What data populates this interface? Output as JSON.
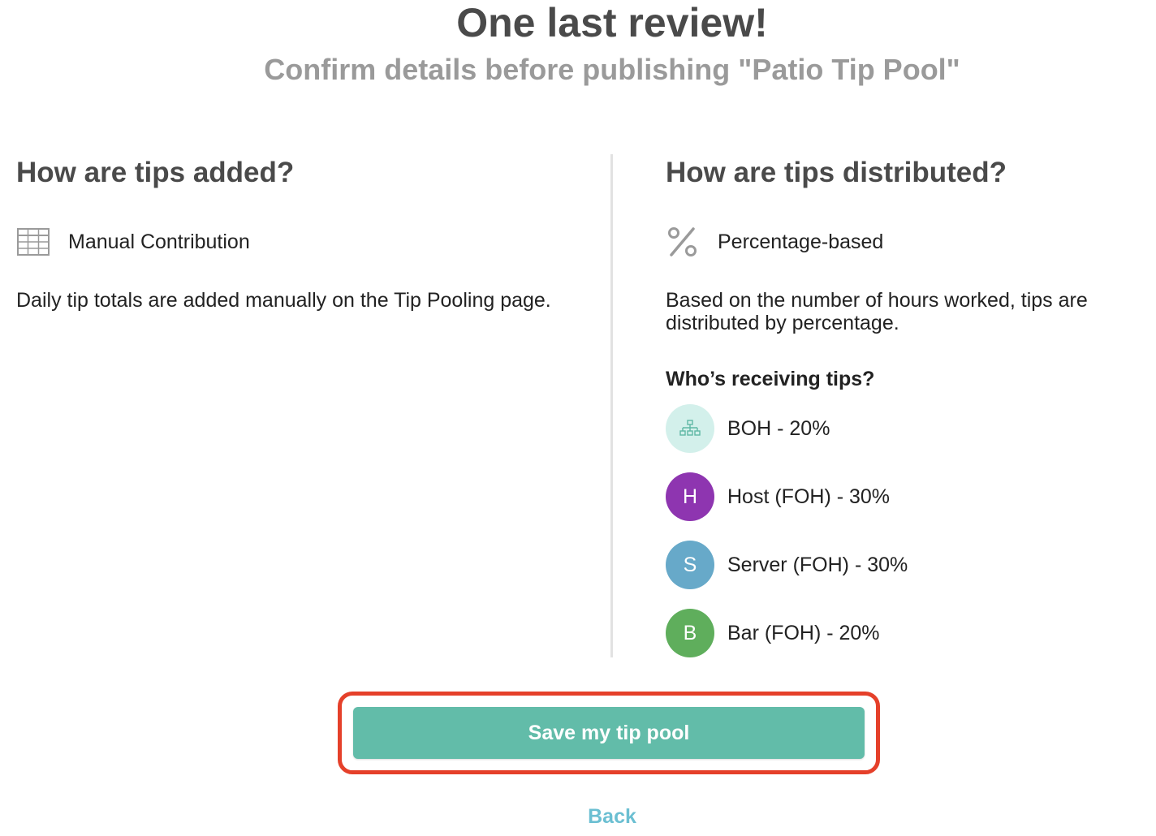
{
  "header": {
    "title": "One last review!",
    "subtitle": "Confirm details before publishing \"Patio Tip Pool\""
  },
  "added": {
    "heading": "How are tips added?",
    "method_icon": "table-grid-icon",
    "method_label": "Manual Contribution",
    "description": "Daily tip totals are added manually on the Tip Pooling page."
  },
  "distributed": {
    "heading": "How are tips distributed?",
    "method_icon": "percent-icon",
    "method_label": "Percentage-based",
    "description": "Based on the number of hours worked, tips are distributed by percentage.",
    "receivers_heading": "Who’s receiving tips?",
    "receivers": [
      {
        "initial": "",
        "icon": "org-chart-icon",
        "label": "BOH - 20%",
        "color": "#d3f0eb"
      },
      {
        "initial": "H",
        "label": "Host (FOH) - 30%",
        "color": "#8e35b0"
      },
      {
        "initial": "S",
        "label": "Server (FOH) - 30%",
        "color": "#67a9c9"
      },
      {
        "initial": "B",
        "label": "Bar (FOH) - 20%",
        "color": "#5fae5c"
      }
    ]
  },
  "actions": {
    "save_label": "Save my tip pool",
    "back_label": "Back"
  },
  "colors": {
    "primary": "#62bca9",
    "highlight": "#e5402a",
    "link": "#6bbfd2"
  }
}
